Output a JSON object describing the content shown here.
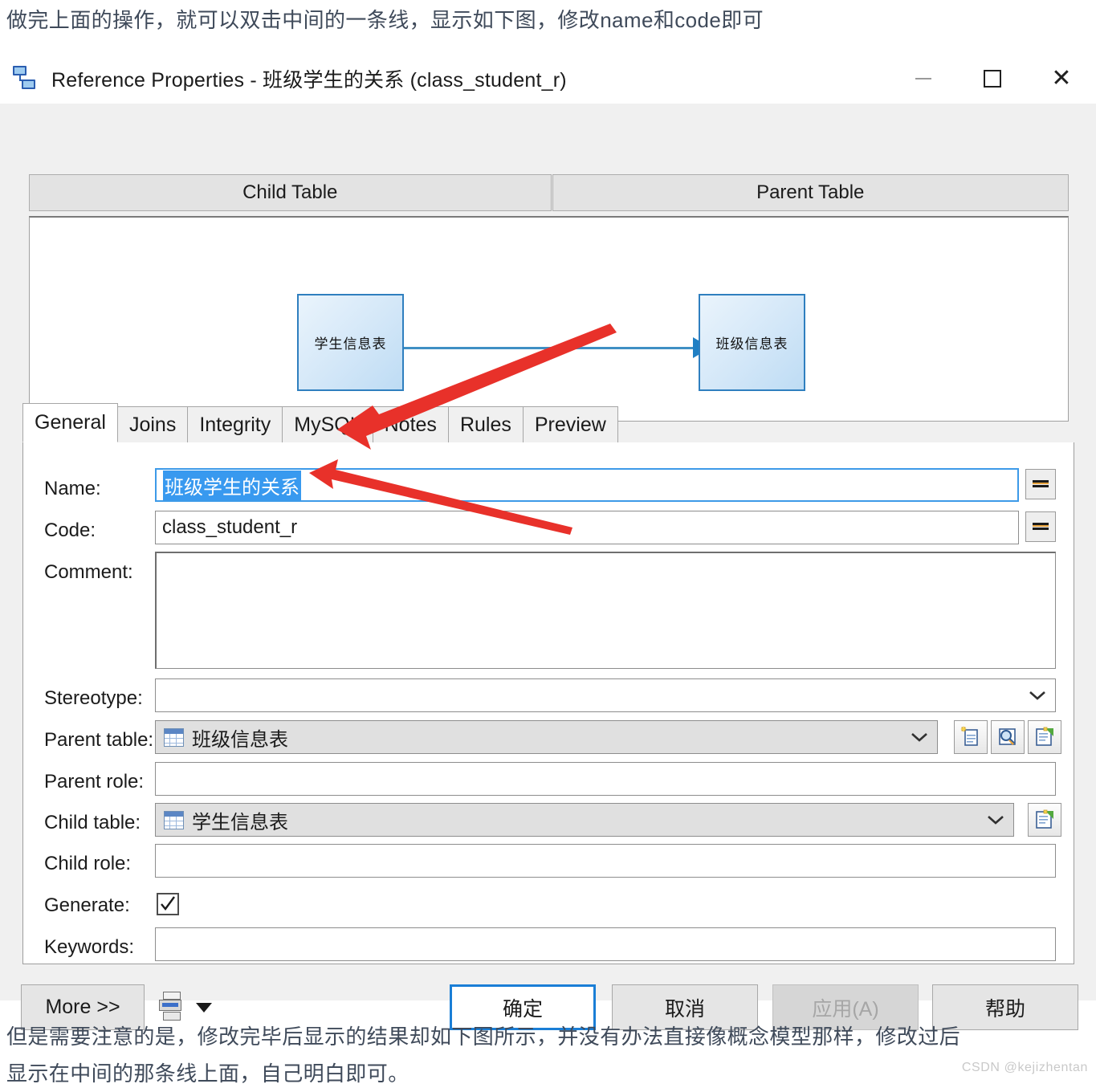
{
  "article": {
    "caption_top": "做完上面的操作，就可以双击中间的一条线，显示如下图，修改name和code即可",
    "caption_bottom": "但是需要注意的是，修改完毕后显示的结果却如下图所示，并没有办法直接像概念模型那样，修改过后\n显示在中间的那条线上面，自己明白即可。",
    "watermark": "CSDN @kejizhentan"
  },
  "window": {
    "title": "Reference Properties - 班级学生的关系 (class_student_r)",
    "icon": "reference-link-icon",
    "minimize_label": "—",
    "maximize_label": "□",
    "close_label": "✕"
  },
  "diagram": {
    "child_header": "Child Table",
    "parent_header": "Parent Table",
    "child_entity": "学生信息表",
    "parent_entity": "班级信息表",
    "link_color": "#3f8fc4",
    "entity_border_color": "#2f7fbf"
  },
  "tabs": [
    {
      "label": "General",
      "active": true
    },
    {
      "label": "Joins",
      "active": false
    },
    {
      "label": "Integrity",
      "active": false
    },
    {
      "label": "MySQL",
      "active": false
    },
    {
      "label": "Notes",
      "active": false
    },
    {
      "label": "Rules",
      "active": false
    },
    {
      "label": "Preview",
      "active": false
    }
  ],
  "form": {
    "name": {
      "label": "Name:",
      "value": "班级学生的关系",
      "selected": true
    },
    "code": {
      "label": "Code:",
      "value": "class_student_r"
    },
    "comment": {
      "label": "Comment:",
      "value": ""
    },
    "stereotype": {
      "label": "Stereotype:",
      "value": ""
    },
    "parent_table": {
      "label": "Parent table:",
      "value": "班级信息表",
      "icon": "table-icon"
    },
    "parent_role": {
      "label": "Parent role:",
      "value": ""
    },
    "child_table": {
      "label": "Child table:",
      "value": "学生信息表",
      "icon": "table-icon"
    },
    "child_role": {
      "label": "Child role:",
      "value": ""
    },
    "generate": {
      "label": "Generate:",
      "checked": true
    },
    "keywords": {
      "label": "Keywords:",
      "value": ""
    },
    "equals_button_label": "=",
    "side_buttons": [
      {
        "name": "create-object-button",
        "title": "新建"
      },
      {
        "name": "browse-object-button",
        "title": "浏览"
      },
      {
        "name": "object-properties-button",
        "title": "属性"
      }
    ]
  },
  "footer": {
    "more": "More >>",
    "print_icon": "print-icon",
    "print_dropdown_icon": "caret-down-icon",
    "ok": "确定",
    "cancel": "取消",
    "apply": "应用(A)",
    "apply_disabled": true,
    "help": "帮助"
  },
  "annotation": {
    "color": "#e8312a",
    "arrow_count": 2,
    "targets": [
      "name-input",
      "code-input"
    ]
  }
}
